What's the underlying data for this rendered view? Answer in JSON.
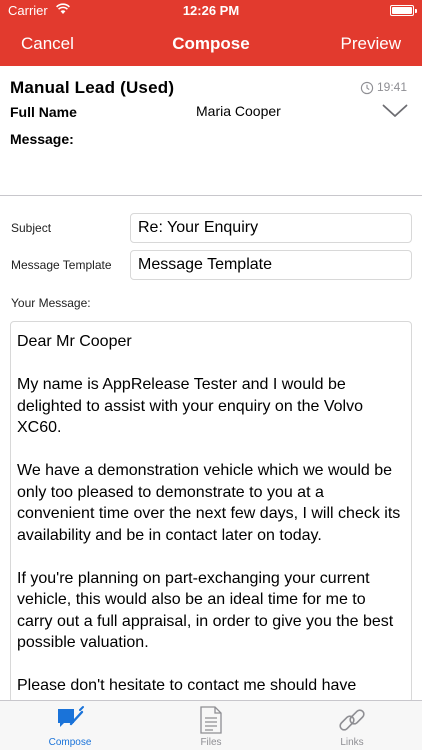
{
  "status_bar": {
    "carrier": "Carrier",
    "time": "12:26 PM",
    "icons": [
      "wifi-icon",
      "battery-icon"
    ]
  },
  "nav": {
    "cancel_label": "Cancel",
    "title": "Compose",
    "preview_label": "Preview",
    "brand_color": "#e23a2e"
  },
  "lead": {
    "title": "Manual Lead (Used)",
    "time": "19:41",
    "full_name_label": "Full Name",
    "full_name_value": "Maria Cooper",
    "message_label": "Message:"
  },
  "form": {
    "subject_label": "Subject",
    "subject_value": "Re: Your Enquiry",
    "template_label": "Message Template",
    "template_value": "Message Template",
    "your_message_label": "Your Message:"
  },
  "message": {
    "paragraphs": [
      "Dear Mr Cooper",
      "My name is AppRelease Tester and I would be delighted to assist with your enquiry on the Volvo XC60.",
      "We have a demonstration vehicle which we would be only too pleased to demonstrate to you at a convenient time over the next few days, I will check its availability and be in contact later on today.",
      "If you're planning on part-exchanging your current vehicle, this would also be an ideal time for me to carry out a full appraisal, in order to give you the best possible valuation.",
      "Please don't hesitate to contact me should have"
    ]
  },
  "tabs": {
    "compose": "Compose",
    "files": "Files",
    "links": "Links",
    "active_color": "#1a73d9",
    "inactive_color": "#8e8e93"
  }
}
